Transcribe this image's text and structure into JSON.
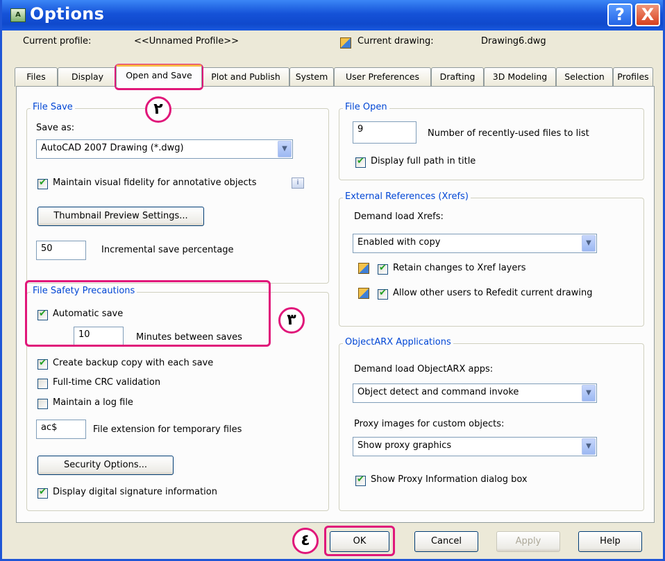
{
  "window": {
    "title": "Options",
    "icon_label": "A",
    "help_glyph": "?",
    "close_glyph": "X"
  },
  "profile": {
    "label": "Current profile:",
    "value": "<<Unnamed Profile>>",
    "drawing_label": "Current drawing:",
    "drawing_value": "Drawing6.dwg"
  },
  "tabs": [
    "Files",
    "Display",
    "Open and Save",
    "Plot and Publish",
    "System",
    "User Preferences",
    "Drafting",
    "3D Modeling",
    "Selection",
    "Profiles"
  ],
  "active_tab": "Open and Save",
  "file_save": {
    "legend": "File Save",
    "save_as_label": "Save as:",
    "save_as_value": "AutoCAD 2007 Drawing (*.dwg)",
    "fidelity_label": "Maintain visual fidelity for annotative objects",
    "fidelity_checked": true,
    "thumbnail_button": "Thumbnail Preview Settings...",
    "incremental_value": "50",
    "incremental_label": "Incremental save percentage"
  },
  "file_safety": {
    "legend": "File Safety Precautions",
    "autosave_label": "Automatic save",
    "autosave_checked": true,
    "minutes_value": "10",
    "minutes_label": "Minutes between saves",
    "backup_label": "Create backup copy with each save",
    "backup_checked": true,
    "crc_label": "Full-time CRC validation",
    "crc_checked": false,
    "log_label": "Maintain a log file",
    "log_checked": false,
    "ext_value": "ac$",
    "ext_label": "File extension for temporary files",
    "security_button": "Security Options...",
    "signature_label": "Display digital signature information",
    "signature_checked": true
  },
  "file_open": {
    "legend": "File Open",
    "recent_value": "9",
    "recent_label": "Number of recently-used files to list",
    "fullpath_label": "Display full path in title",
    "fullpath_checked": true
  },
  "xrefs": {
    "legend": "External References (Xrefs)",
    "demand_label": "Demand load Xrefs:",
    "demand_value": "Enabled with copy",
    "retain_label": "Retain changes to Xref layers",
    "retain_checked": true,
    "refedit_label": "Allow other users to Refedit current drawing",
    "refedit_checked": true
  },
  "objectarx": {
    "legend": "ObjectARX Applications",
    "demand_label": "Demand load ObjectARX apps:",
    "demand_value": "Object detect and command invoke",
    "proxy_label": "Proxy images for custom objects:",
    "proxy_value": "Show proxy graphics",
    "proxy_info_label": "Show Proxy Information dialog box",
    "proxy_info_checked": true
  },
  "buttons": {
    "ok": "OK",
    "cancel": "Cancel",
    "apply": "Apply",
    "help": "Help"
  },
  "callouts": {
    "tab": "٢",
    "safety": "٣",
    "ok": "٤"
  },
  "colors": {
    "title_bar": "#1552d8",
    "group_legend": "#0046d5",
    "callout": "#e0177a"
  }
}
